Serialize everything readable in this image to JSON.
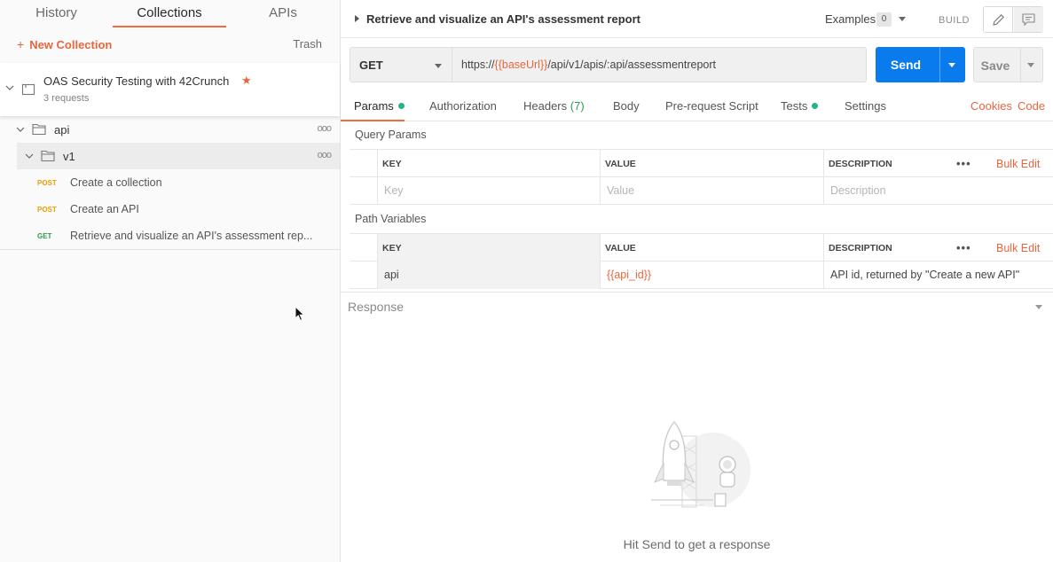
{
  "sidebar": {
    "tabs": [
      "History",
      "Collections",
      "APIs"
    ],
    "new_collection": "New Collection",
    "trash": "Trash",
    "collection": {
      "name": "OAS Security Testing with 42Crunch",
      "count": "3 requests"
    },
    "folders": [
      {
        "name": "api"
      },
      {
        "name": "v1"
      }
    ],
    "requests": [
      {
        "method": "POST",
        "name": "Create a collection"
      },
      {
        "method": "POST",
        "name": "Create an API"
      },
      {
        "method": "GET",
        "name": "Retrieve and visualize an API's assessment rep..."
      }
    ]
  },
  "request": {
    "title": "Retrieve and visualize an API's assessment report",
    "examples_label": "Examples",
    "examples_count": "0",
    "build_label": "BUILD",
    "method": "GET",
    "url_prefix": "https://",
    "url_var": "{{baseUrl}}",
    "url_suffix": "/api/v1/apis/:api/assessmentreport",
    "send": "Send",
    "save": "Save"
  },
  "tabs": {
    "params": "Params",
    "authorization": "Authorization",
    "headers": "Headers",
    "headers_count": "(7)",
    "body": "Body",
    "prerequest": "Pre-request Script",
    "tests": "Tests",
    "settings": "Settings",
    "cookies": "Cookies",
    "code": "Code"
  },
  "query_params": {
    "title": "Query Params",
    "headers": [
      "KEY",
      "VALUE",
      "DESCRIPTION"
    ],
    "bulk_edit": "Bulk Edit",
    "placeholders": {
      "key": "Key",
      "value": "Value",
      "description": "Description"
    }
  },
  "path_variables": {
    "title": "Path Variables",
    "headers": [
      "KEY",
      "VALUE",
      "DESCRIPTION"
    ],
    "bulk_edit": "Bulk Edit",
    "rows": [
      {
        "key": "api",
        "value": "{{api_id}}",
        "description": "API id, returned by \"Create a new API\""
      }
    ]
  },
  "response": {
    "label": "Response",
    "empty_text": "Hit Send to get a response"
  },
  "colors": {
    "accent": "#f26b3a",
    "send_blue": "#097bed",
    "post": "#e8a000",
    "get": "#2a9d4e",
    "dot": "#26b47f"
  }
}
